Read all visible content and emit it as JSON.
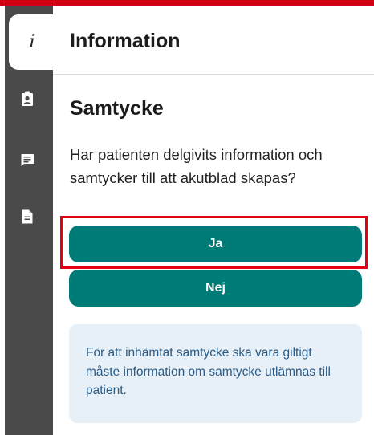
{
  "rail": {
    "active_tab_glyph": "i",
    "icons": [
      "info-icon",
      "patient-badge-icon",
      "message-icon",
      "document-icon"
    ]
  },
  "header": {
    "title": "Information"
  },
  "consent": {
    "title": "Samtycke",
    "question": "Har patienten delgivits information och samtycker till att akutblad skapas?",
    "yes_label": "Ja",
    "no_label": "Nej",
    "info_text": "För att inhämtat samtycke ska vara giltigt måste information om samtycke utlämnas till patient."
  },
  "colors": {
    "accent": "#007c78",
    "rail": "#4a4a4a",
    "highlight": "#e3000f",
    "info_bg": "#e7eff7",
    "info_text": "#2a5c86"
  }
}
